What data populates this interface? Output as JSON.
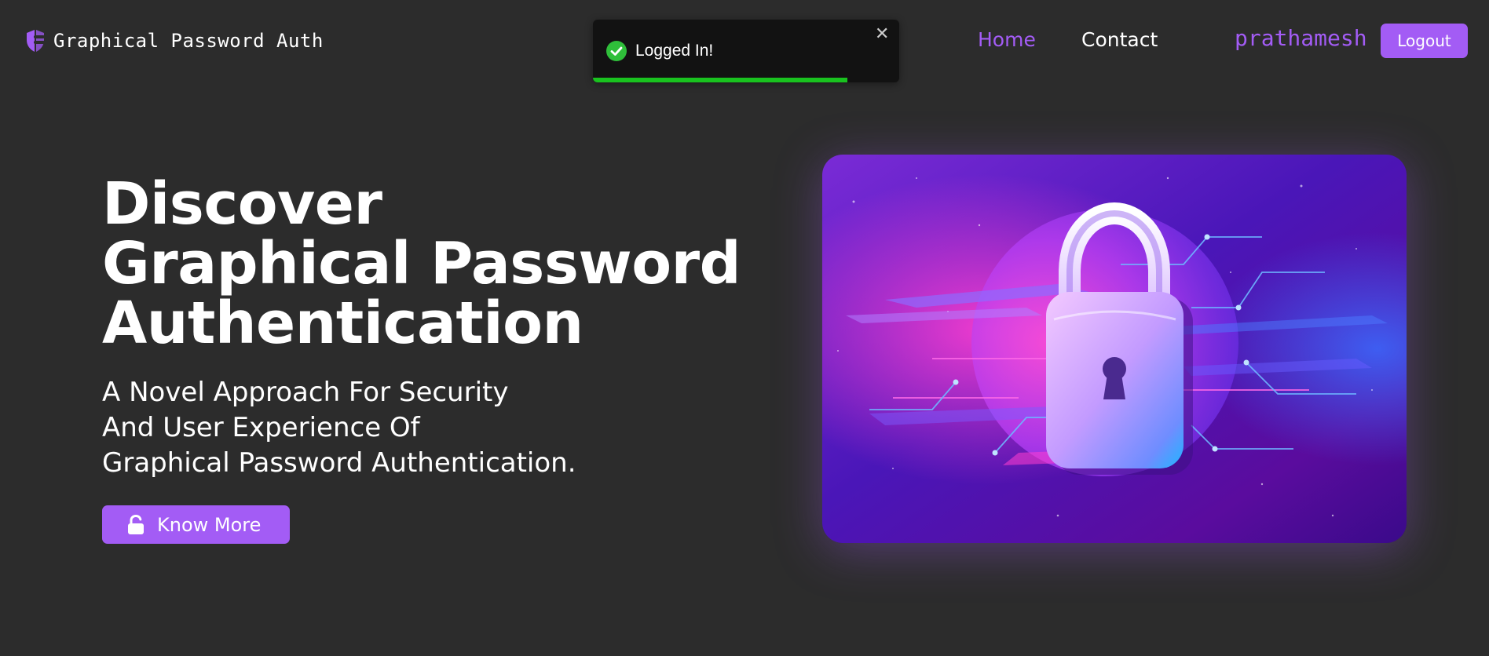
{
  "nav": {
    "brand_title": "Graphical Password Auth",
    "brand_icon": "shield-key-icon",
    "links": [
      {
        "label": "Home",
        "active": true
      },
      {
        "label": "Contact",
        "active": false
      }
    ],
    "username": "prathamesh",
    "logout_label": "Logout"
  },
  "toast": {
    "message": "Logged In!",
    "status": "success",
    "close_glyph": "✕",
    "progress": 0.83
  },
  "hero": {
    "title_lines": [
      "Discover",
      "Graphical Password",
      "Authentication"
    ],
    "subtitle_lines": [
      "A Novel Approach For Security",
      "And User Experience Of",
      "Graphical Password Authentication."
    ],
    "cta_label": "Know More",
    "cta_icon": "unlock-icon",
    "image": "padlock-illustration"
  },
  "colors": {
    "background": "#2c2c2c",
    "accent": "#a35cf5",
    "toast_bg": "#121212",
    "success": "#19c21f"
  }
}
